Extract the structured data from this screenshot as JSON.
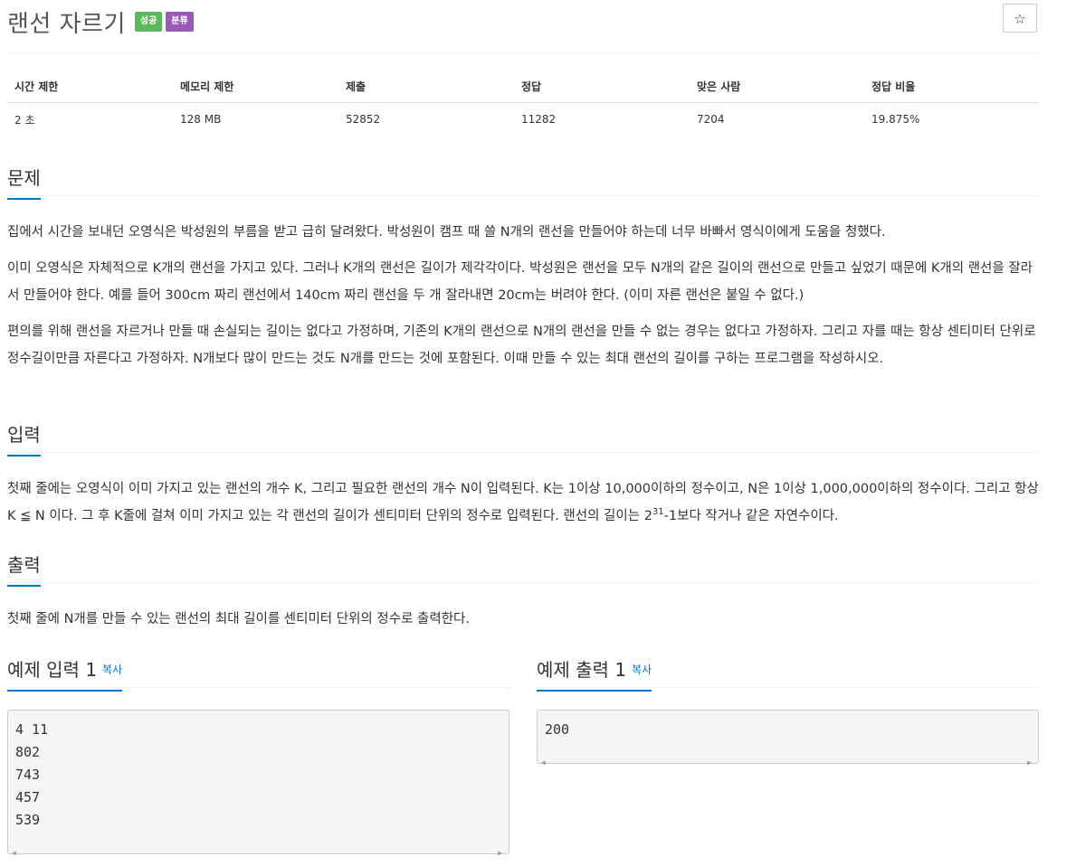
{
  "problem": {
    "title": "랜선 자르기",
    "badges": {
      "success": "성공",
      "class": "분류"
    },
    "star_icon": "☆"
  },
  "info_table": {
    "headers": [
      "시간 제한",
      "메모리 제한",
      "제출",
      "정답",
      "맞은 사람",
      "정답 비율"
    ],
    "values": [
      "2 초",
      "128 MB",
      "52852",
      "11282",
      "7204",
      "19.875%"
    ]
  },
  "sections": {
    "description": {
      "title": "문제",
      "paragraphs": [
        "집에서 시간을 보내던 오영식은 박성원의 부름을 받고 급히 달려왔다. 박성원이 캠프 때 쓸 N개의 랜선을 만들어야 하는데 너무 바빠서 영식이에게 도움을 청했다.",
        "이미 오영식은 자체적으로 K개의 랜선을 가지고 있다. 그러나 K개의 랜선은 길이가 제각각이다. 박성원은 랜선을 모두 N개의 같은 길이의 랜선으로 만들고 싶었기 때문에 K개의 랜선을 잘라서 만들어야 한다. 예를 들어 300cm 짜리 랜선에서 140cm 짜리 랜선을 두 개 잘라내면 20cm는 버려야 한다. (이미 자른 랜선은 붙일 수 없다.)",
        "편의를 위해 랜선을 자르거나 만들 때 손실되는 길이는 없다고 가정하며, 기존의 K개의 랜선으로 N개의 랜선을 만들 수 없는 경우는 없다고 가정하자. 그리고 자를 때는 항상 센티미터 단위로 정수길이만큼 자른다고 가정하자. N개보다 많이 만드는 것도 N개를 만드는 것에 포함된다. 이때 만들 수 있는 최대 랜선의 길이를 구하는 프로그램을 작성하시오."
      ]
    },
    "input": {
      "title": "입력",
      "text_before_sup": "첫째 줄에는 오영식이 이미 가지고 있는 랜선의 개수 K, 그리고 필요한 랜선의 개수 N이 입력된다. K는 1이상 10,000이하의 정수이고, N은 1이상 1,000,000이하의 정수이다. 그리고 항상 K ≦ N 이다. 그 후 K줄에 걸쳐 이미 가지고 있는 각 랜선의 길이가 센티미터 단위의 정수로 입력된다. 랜선의 길이는 2",
      "sup": "31",
      "text_after_sup": "-1보다 작거나 같은 자연수이다."
    },
    "output": {
      "title": "출력",
      "text": "첫째 줄에 N개를 만들 수 있는 랜선의 최대 길이를 센티미터 단위의 정수로 출력한다."
    }
  },
  "samples": {
    "input": {
      "title": "예제 입력 1",
      "copy_label": "복사",
      "lines": [
        "4 11",
        "802",
        "743",
        "457",
        "539"
      ]
    },
    "output": {
      "title": "예제 출력 1",
      "copy_label": "복사",
      "lines": [
        "200"
      ]
    }
  },
  "scroll_arrows": {
    "left": "◀",
    "right": "▶"
  }
}
